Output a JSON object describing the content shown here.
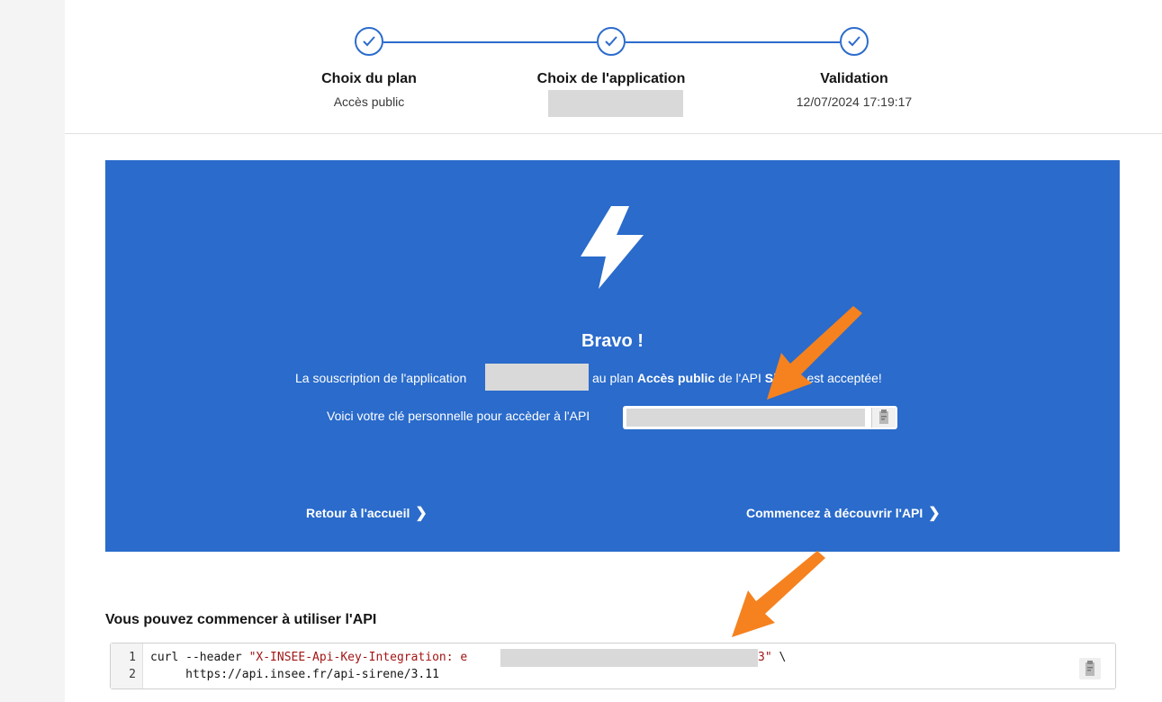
{
  "steps": [
    {
      "title": "Choix du plan",
      "subtitle": "Accès public"
    },
    {
      "title": "Choix de l'application",
      "subtitle": ""
    },
    {
      "title": "Validation",
      "subtitle": "12/07/2024 17:19:17"
    }
  ],
  "banner": {
    "heading": "Bravo !",
    "sub_prefix": "La souscription de l'application",
    "sub_mid": "au plan",
    "plan": "Accès public",
    "sub_api": "de l'API",
    "api_name": "Sirene",
    "sub_suffix": "est acceptée!",
    "key_label": "Voici votre clé personnelle pour accèder à l'API",
    "link_home": "Retour à l'accueil",
    "link_discover": "Commencez à découvrir l'API"
  },
  "code": {
    "title": "Vous pouvez commencer à utiliser l'API",
    "lines": [
      {
        "num": "1",
        "pre": "curl --header ",
        "str_start": "\"X-INSEE-Api-Key-Integration: e",
        "str_end": "3\"",
        "post": " \\"
      },
      {
        "num": "2",
        "text": "     https://api.insee.fr/api-sirene/3.11"
      }
    ]
  },
  "colors": {
    "banner": "#2a6bcb",
    "accent": "#2d6ccc",
    "arrow": "#f5821f"
  },
  "icons": [
    "check-icon",
    "lightning-bolt-icon",
    "clipboard-icon",
    "chevron-right-icon",
    "arrow-annotation-icon"
  ]
}
